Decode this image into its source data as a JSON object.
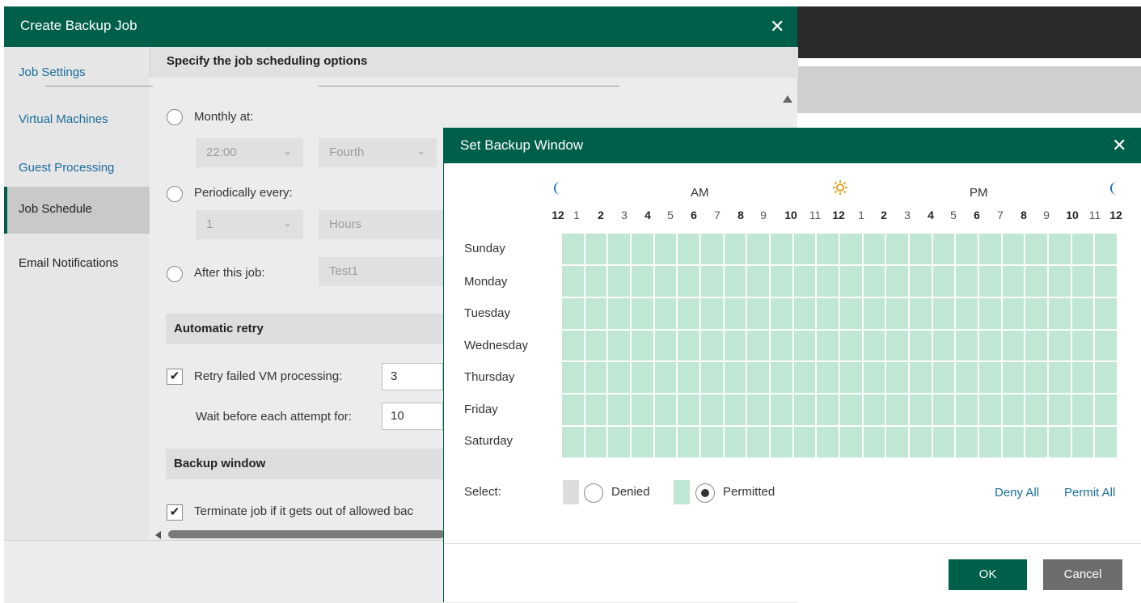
{
  "main_window": {
    "title": "Create Backup Job",
    "close_glyph": "✕",
    "sidebar": [
      {
        "label": "Job Settings"
      },
      {
        "label": "Virtual Machines"
      },
      {
        "label": "Guest Processing"
      },
      {
        "label": "Job Schedule"
      },
      {
        "label": "Email Notifications"
      }
    ],
    "active_sidebar_item": "Job Schedule",
    "header": "Specify the job scheduling options",
    "monthly_label": "Monthly at:",
    "monthly_time": "22:00",
    "monthly_week": "Fourth",
    "periodic_label": "Periodically every:",
    "periodic_value": "1",
    "periodic_unit": "Hours",
    "after_job_label": "After this job:",
    "after_job_value": "Test1",
    "auto_retry_header": "Automatic retry",
    "retry_label": "Retry failed VM processing:",
    "retry_value": "3",
    "wait_label": "Wait before each attempt for:",
    "wait_value": "10",
    "backup_window_header": "Backup window",
    "terminate_label": "Terminate job if it gets out of allowed bac",
    "check_glyph": "✔"
  },
  "dialog": {
    "title": "Set Backup Window",
    "close_glyph": "✕",
    "am_label": "AM",
    "pm_label": "PM",
    "icons": [
      "moon-icon",
      "sun-icon",
      "moon-icon"
    ],
    "hours": [
      "12",
      "1",
      "2",
      "3",
      "4",
      "5",
      "6",
      "7",
      "8",
      "9",
      "10",
      "11",
      "12",
      "1",
      "2",
      "3",
      "4",
      "5",
      "6",
      "7",
      "8",
      "9",
      "10",
      "11",
      "12"
    ],
    "days": [
      "Sunday",
      "Monday",
      "Tuesday",
      "Wednesday",
      "Thursday",
      "Friday",
      "Saturday"
    ],
    "grid_state": "permitted",
    "select_label": "Select:",
    "denied_label": "Denied",
    "permitted_label": "Permitted",
    "selected_option": "Permitted",
    "deny_all": "Deny All",
    "permit_all": "Permit All",
    "ok": "OK",
    "cancel": "Cancel"
  },
  "colors": {
    "brand": "#005f4b",
    "permitted": "#bfe7d4",
    "denied": "#dcdcdc",
    "link": "#1a6d9c",
    "cancel": "#6d6d6d"
  }
}
